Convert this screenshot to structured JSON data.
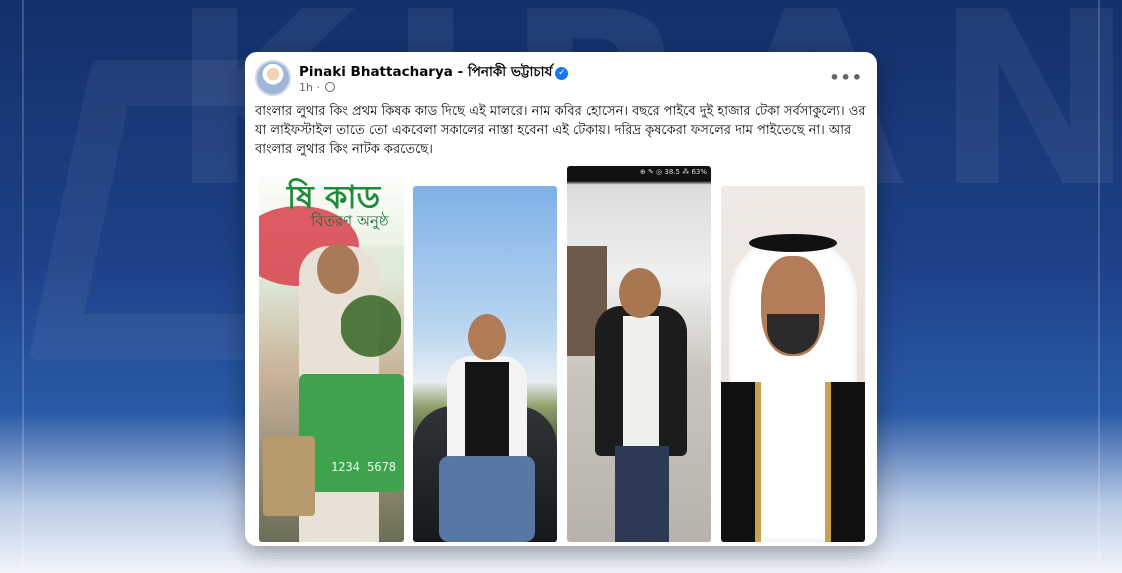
{
  "background": {
    "watermark_text": "KIBANGLA",
    "colors": {
      "top": "#14306b",
      "bottom": "#f2f5fb"
    }
  },
  "post": {
    "author": "Pinaki Bhattacharya - পিনাকী ভট্টাচার্য",
    "verified": true,
    "time": "1h",
    "privacy_icon": "globe-icon",
    "more_icon": "more-options-icon",
    "more_label": "•••",
    "text": "বাংলার লুথার কিং প্রথম কিষক কাড দিছে এই মালরে। নাম কবির হোসেন। বছরে পাইবে দুই হাজার টেকা সর্বসাকুল্যে। ওর যা লাইফস্টাইল তাতে তো একবেলা সকালের নাস্তা হবেনা এই টেকায়। দরিদ্র কৃষকেরা ফসলের দাম পাইতেছে না। আর বাংলার লুথার কিং নাটক করতেছে।",
    "photos": [
      {
        "banner_text": "ষি কাড",
        "banner_sub": "বিতরণ অনুষ্ঠ",
        "card_number": "1234 5678"
      },
      {
        "description": "man-by-car"
      },
      {
        "status_bar": "⊕ ✎ ◎ 38.5 ⁂ 63%"
      },
      {
        "description": "man-in-arab-dress"
      }
    ]
  }
}
